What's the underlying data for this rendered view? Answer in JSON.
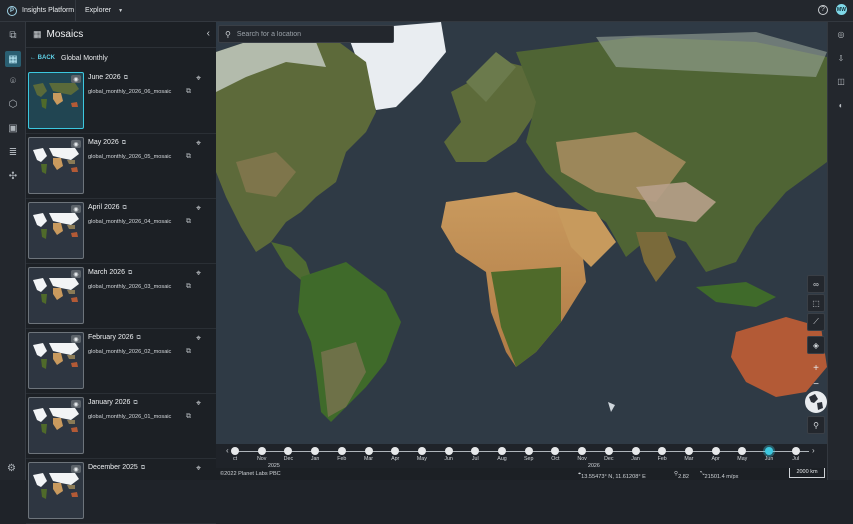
{
  "app": {
    "brand_initial": "P",
    "brand_name": "Insights Platform",
    "section": "Explorer",
    "user_initials": "MW"
  },
  "panel": {
    "title": "Mosaics",
    "back_label": "BACK",
    "crumb": "Global Monthly"
  },
  "mosaics": [
    {
      "title": "June 2026",
      "name": "global_monthly_2026_06_mosaic",
      "selected": true
    },
    {
      "title": "May 2026",
      "name": "global_monthly_2026_05_mosaic"
    },
    {
      "title": "April 2026",
      "name": "global_monthly_2026_04_mosaic"
    },
    {
      "title": "March 2026",
      "name": "global_monthly_2026_03_mosaic"
    },
    {
      "title": "February 2026",
      "name": "global_monthly_2026_02_mosaic"
    },
    {
      "title": "January 2026",
      "name": "global_monthly_2026_01_mosaic"
    },
    {
      "title": "December 2025",
      "name": ""
    }
  ],
  "search": {
    "placeholder": "Search for a location",
    "value": ""
  },
  "timeline": {
    "months": [
      "ct",
      "Nov",
      "Dec",
      "Jan",
      "Feb",
      "Mar",
      "Apr",
      "May",
      "Jun",
      "Jul",
      "Aug",
      "Sep",
      "Oct",
      "Nov",
      "Dec",
      "Jan",
      "Feb",
      "Mar",
      "Apr",
      "May",
      "Jun",
      "Jul"
    ],
    "selected_month": "Jun",
    "years": [
      "2025",
      "2026"
    ]
  },
  "status": {
    "copyright": "©2022 Planet Labs PBC",
    "coords": "13.55473° N, 11.61208° E",
    "zoom": "2.82",
    "resolution": "21501.4 m/px",
    "scale": "2000 km"
  },
  "colors": {
    "accent": "#3cc8e0",
    "ocean": "#2f3a45",
    "panel": "#1c2025"
  }
}
